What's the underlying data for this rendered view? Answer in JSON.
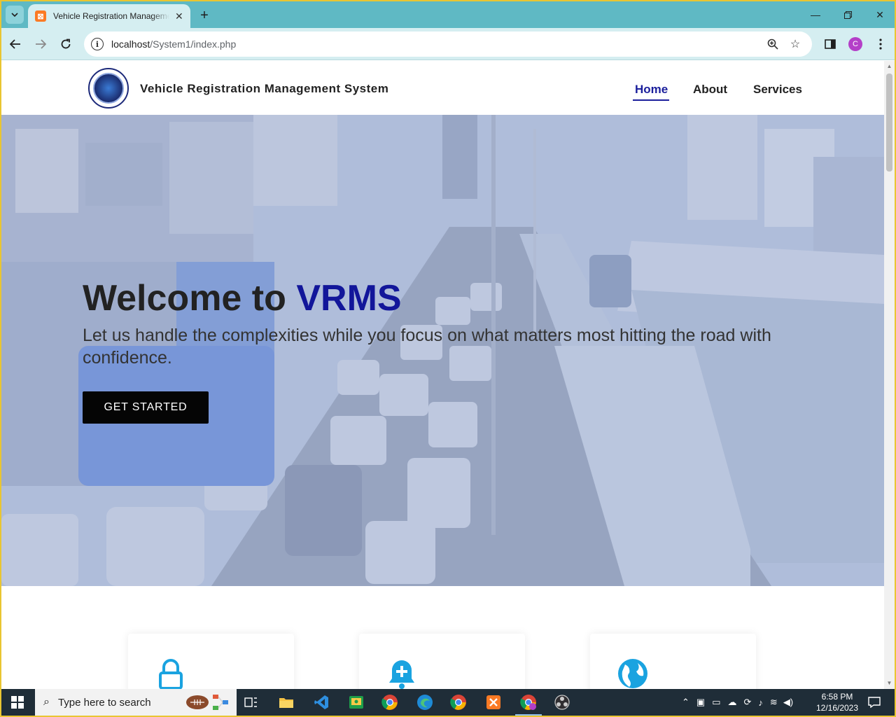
{
  "browser": {
    "tab_title": "Vehicle Registration Management System",
    "tab_favicon": "xampp-icon",
    "url_host": "localhost",
    "url_path": "/System1/index.php",
    "profile_initial": "C"
  },
  "site": {
    "brand": "Vehicle Registration Management System",
    "nav": [
      {
        "label": "Home",
        "active": true
      },
      {
        "label": "About",
        "active": false
      },
      {
        "label": "Services",
        "active": false
      }
    ]
  },
  "hero": {
    "title_prefix": "Welcome to ",
    "title_accent": "VRMS",
    "subtitle": "Let us handle the complexities while you focus on what matters most hitting the road with confidence.",
    "cta_label": "GET STARTED"
  },
  "cards": [
    {
      "icon": "lock-icon"
    },
    {
      "icon": "bell-plus-icon"
    },
    {
      "icon": "globe-icon"
    }
  ],
  "taskbar": {
    "search_placeholder": "Type here to search",
    "time": "6:58 PM",
    "date": "12/16/2023"
  },
  "colors": {
    "accent": "#12169a",
    "browser_frame": "#5fb9c4",
    "card_icon": "#1aa3e0"
  }
}
